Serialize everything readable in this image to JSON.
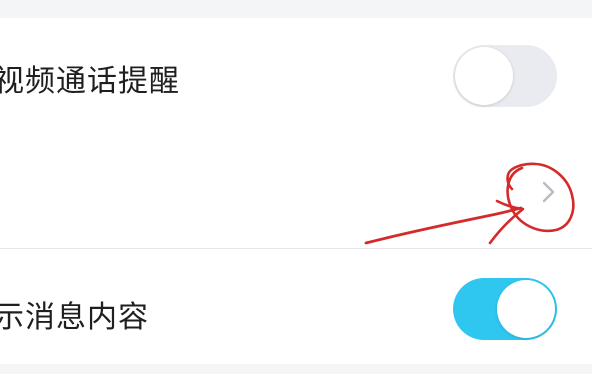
{
  "settings": {
    "video_call_reminder": {
      "label": "视频通话提醒",
      "enabled": false
    },
    "arrow_row": {
      "icon": "chevron-right-icon"
    },
    "show_message_content": {
      "label": "示消息内容",
      "enabled": true
    }
  },
  "colors": {
    "toggle_on": "#2fc7f0",
    "toggle_off": "#e9ebf0",
    "annotation": "#d42a2a"
  }
}
